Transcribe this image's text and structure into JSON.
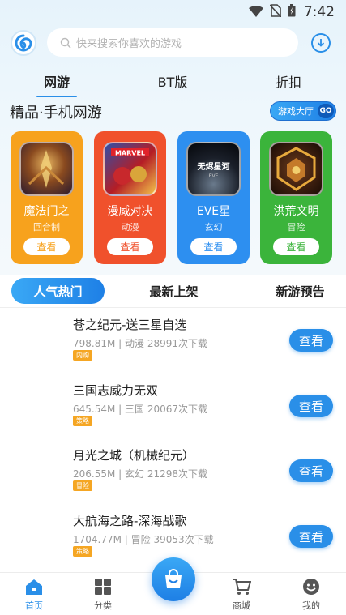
{
  "status_bar": {
    "time": "7:42"
  },
  "search": {
    "placeholder": "快来搜索你喜欢的游戏"
  },
  "top_tabs": [
    {
      "label": "网游",
      "active": true
    },
    {
      "label": "BT版",
      "active": false
    },
    {
      "label": "折扣",
      "active": false
    }
  ],
  "section": {
    "title": "精品·手机网游",
    "lobby_label": "游戏大厅",
    "lobby_go": "GO"
  },
  "featured": [
    {
      "name": "魔法门之",
      "category": "回合制",
      "view_label": "查看",
      "color": "#f7a21d"
    },
    {
      "name": "漫威对决",
      "category": "动漫",
      "view_label": "查看",
      "color": "#f0512c"
    },
    {
      "name": "EVE星",
      "category": "玄幻",
      "view_label": "查看",
      "color": "#2d8ff0"
    },
    {
      "name": "洪荒文明",
      "category": "冒险",
      "view_label": "查看",
      "color": "#3bb43b"
    }
  ],
  "sub_tabs": [
    {
      "label": "人气热门",
      "active": true
    },
    {
      "label": "最新上架",
      "active": false
    },
    {
      "label": "新游预告",
      "active": false
    }
  ],
  "games": [
    {
      "title": "苍之纪元-送三星自选",
      "meta": "798.81M | 动漫  28991次下载",
      "tag": "内购",
      "tag_color": "#f5a623",
      "button": "查看"
    },
    {
      "title": "三国志威力无双",
      "meta": "645.54M | 三国  20067次下载",
      "tag": "策略",
      "tag_color": "#f5a623",
      "button": "查看"
    },
    {
      "title": "月光之城（机械纪元）",
      "meta": "206.55M | 玄幻  21298次下载",
      "tag": "冒险",
      "tag_color": "#f5a623",
      "button": "查看"
    },
    {
      "title": "大航海之路-深海战歌",
      "meta": "1704.77M | 冒险  39053次下载",
      "tag": "策略",
      "tag_color": "#f5a623",
      "button": "查看"
    }
  ],
  "bottom_nav": [
    {
      "label": "首页",
      "icon": "home-icon",
      "active": true
    },
    {
      "label": "分类",
      "icon": "grid-icon",
      "active": false
    },
    {
      "label": "商城",
      "icon": "cart-icon",
      "active": false
    },
    {
      "label": "我的",
      "icon": "profile-icon",
      "active": false
    }
  ],
  "colors": {
    "accent": "#2a8fe8"
  }
}
